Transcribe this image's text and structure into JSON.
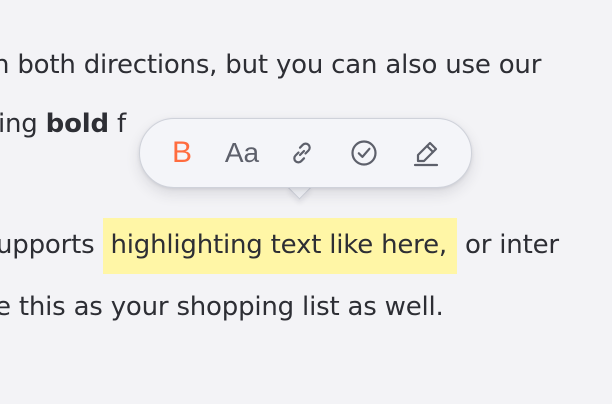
{
  "text": {
    "line1": "n both directions, but you can also use our",
    "line2_before": "ing ",
    "line2_bold": "bold",
    "line2_after": " f",
    "line3_before": "upports ",
    "line3_highlight": "highlighting text like here,",
    "line3_after": " or inter",
    "line4": "e this as your shopping list as well."
  },
  "toolbar": {
    "bold_label": "B",
    "font_size_label": "Aa",
    "icons": [
      "link-icon",
      "check-circle-icon",
      "highlighter-pen-icon"
    ]
  },
  "colors": {
    "bold_accent": "#ff6c3f",
    "highlight": "#fff6a6",
    "icon": "#5d606b"
  }
}
